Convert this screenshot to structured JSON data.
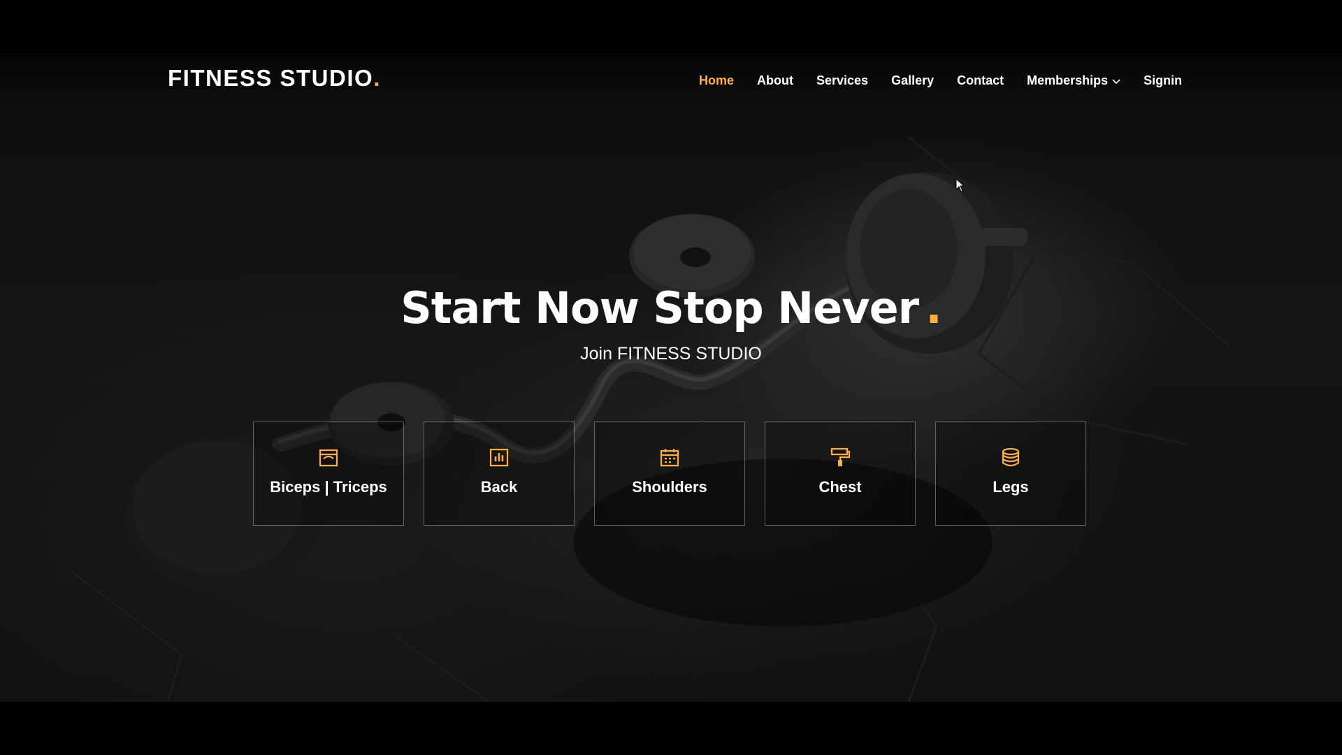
{
  "brand": {
    "name": "FITNESS STUDIO",
    "dot": ".",
    "accent_color": "#ffb03b"
  },
  "nav": {
    "items": [
      {
        "label": "Home",
        "active": true
      },
      {
        "label": "About"
      },
      {
        "label": "Services"
      },
      {
        "label": "Gallery"
      },
      {
        "label": "Contact"
      },
      {
        "label": "Memberships",
        "icon": "chevron-down-icon"
      },
      {
        "label": "Signin"
      }
    ]
  },
  "hero": {
    "title": "Start Now Stop Never",
    "title_dot": ".",
    "subtitle": "Join FITNESS STUDIO"
  },
  "categories": [
    {
      "label": "Biceps | Triceps",
      "icon": "store-icon"
    },
    {
      "label": "Back",
      "icon": "bar-chart-icon"
    },
    {
      "label": "Shoulders",
      "icon": "calendar-icon"
    },
    {
      "label": "Chest",
      "icon": "paint-roller-icon"
    },
    {
      "label": "Legs",
      "icon": "database-icon"
    }
  ]
}
